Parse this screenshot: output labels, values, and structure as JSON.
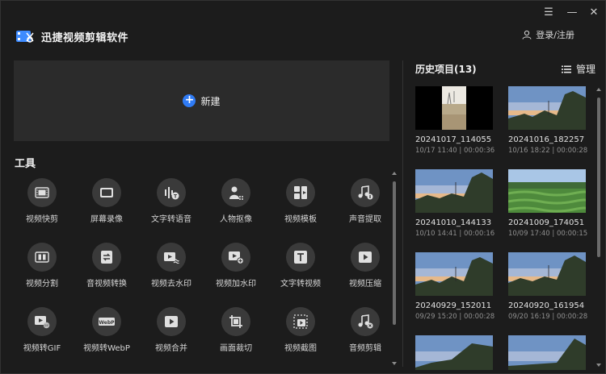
{
  "app": {
    "name": "迅捷视频剪辑软件",
    "login_label": "登录/注册",
    "window_controls": [
      "menu",
      "minimize",
      "close"
    ]
  },
  "new_project": {
    "label": "新建"
  },
  "tools": {
    "title": "工具",
    "items": [
      {
        "label": "视频快剪",
        "icon": "film-icon"
      },
      {
        "label": "屏幕录像",
        "icon": "screen-record-icon"
      },
      {
        "label": "文字转语音",
        "icon": "text-to-speech-icon"
      },
      {
        "label": "人物抠像",
        "icon": "person-cutout-icon"
      },
      {
        "label": "视频模板",
        "icon": "template-icon"
      },
      {
        "label": "声音提取",
        "icon": "music-extract-icon"
      },
      {
        "label": "视频分割",
        "icon": "split-icon"
      },
      {
        "label": "音视频转换",
        "icon": "convert-icon"
      },
      {
        "label": "视频去水印",
        "icon": "remove-watermark-icon"
      },
      {
        "label": "视频加水印",
        "icon": "add-watermark-icon"
      },
      {
        "label": "文字转视频",
        "icon": "text-to-video-icon"
      },
      {
        "label": "视频压缩",
        "icon": "compress-icon"
      },
      {
        "label": "视频转GIF",
        "icon": "gif-icon"
      },
      {
        "label": "视频转WebP",
        "icon": "webp-icon"
      },
      {
        "label": "视频合并",
        "icon": "merge-icon"
      },
      {
        "label": "画面裁切",
        "icon": "crop-icon"
      },
      {
        "label": "视频截图",
        "icon": "screenshot-icon"
      },
      {
        "label": "音频剪辑",
        "icon": "audio-edit-icon"
      }
    ]
  },
  "history": {
    "title": "历史项目(13)",
    "manage_label": "管理",
    "items": [
      {
        "name": "20241017_114055",
        "meta": "10/17 11:40 | 00:00:36",
        "thumb": "portrait"
      },
      {
        "name": "20241016_182257",
        "meta": "10/16 18:22 | 00:00:28",
        "thumb": "sunset"
      },
      {
        "name": "20241010_144133",
        "meta": "10/10 14:41 | 00:00:16",
        "thumb": "sunset"
      },
      {
        "name": "20241009_174051",
        "meta": "10/09 17:40 | 00:00:15",
        "thumb": "field"
      },
      {
        "name": "20240929_152011",
        "meta": "09/29 15:20 | 00:00:28",
        "thumb": "sunset"
      },
      {
        "name": "20240920_161954",
        "meta": "09/20 16:19 | 00:00:28",
        "thumb": "sunset"
      },
      {
        "name": "",
        "meta": "",
        "thumb": "sunset"
      },
      {
        "name": "",
        "meta": "",
        "thumb": "sunset"
      }
    ]
  },
  "colors": {
    "accent": "#2f7bf5",
    "bg": "#1c1c1c",
    "panel": "#2b2b2b",
    "icon_bg": "#3a3a3a"
  }
}
